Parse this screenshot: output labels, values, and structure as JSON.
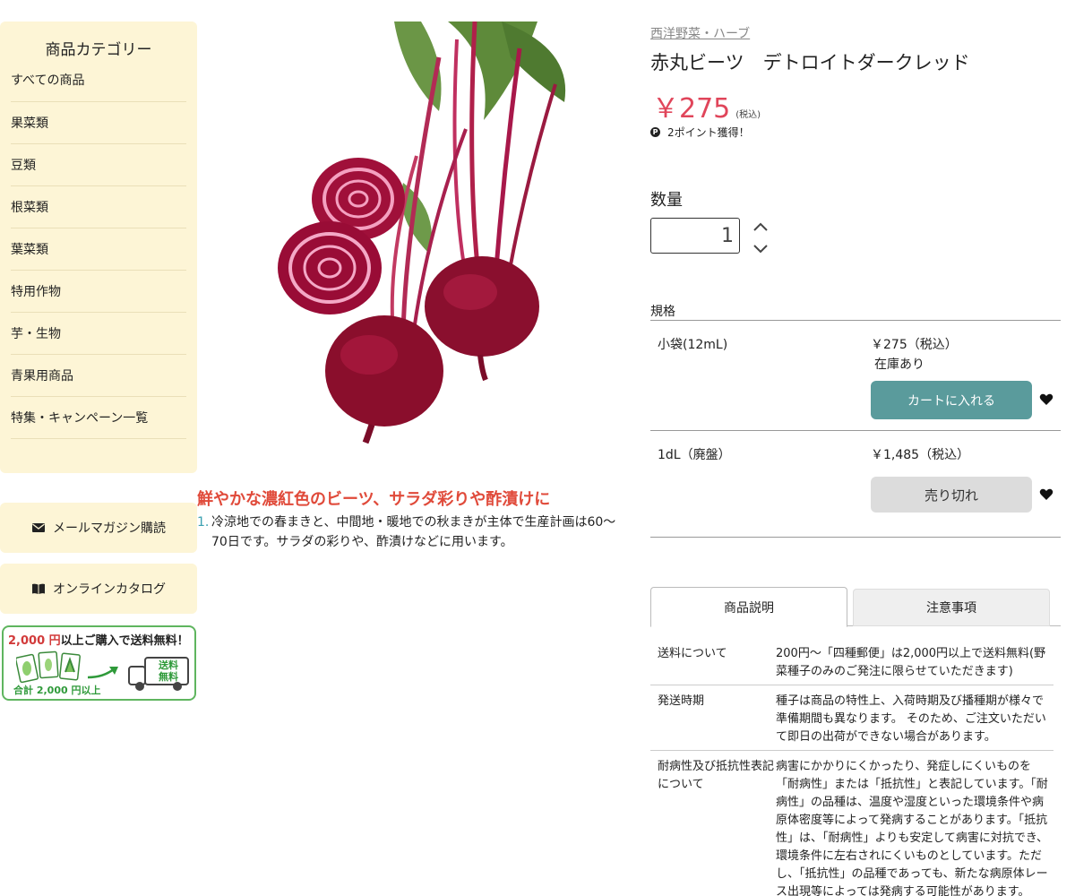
{
  "sidebar": {
    "category_title": "商品カテゴリー",
    "categories": [
      "すべての商品",
      "果菜類",
      "豆類",
      "根菜類",
      "葉菜類",
      "特用作物",
      "芋・生物",
      "青果用商品",
      "特集・キャンペーン一覧"
    ],
    "newsletter_label": "メールマガジン購読",
    "catalog_label": "オンラインカタログ",
    "shipping_banner": {
      "amount": "2,000 円",
      "text": "以上ご購入で送料無料！",
      "sub": "合計 2,000 円以上",
      "truck_text": "送料無料"
    }
  },
  "product": {
    "breadcrumb": "西洋野菜・ハーブ",
    "title": "赤丸ビーツ　デトロイトダークレッド",
    "price": "￥275",
    "tax_note": "(税込)",
    "points": "2ポイント獲得！",
    "catchphrase": "鮮やかな濃紅色のビーツ、サラダ彩りや酢漬けに",
    "description_num": "1.",
    "description": "冷涼地での春まきと、中間地・暖地での秋まきが主体で生産計画は60～70日です。サラダの彩りや、酢漬けなどに用います。"
  },
  "quantity": {
    "label": "数量",
    "value": "1"
  },
  "spec": {
    "label": "規格",
    "rows": [
      {
        "name": "小袋(12mL)",
        "price": "￥275（税込）",
        "stock": "在庫あり",
        "button": "カートに入れる"
      },
      {
        "name": "1dL（廃盤）",
        "price": "￥1,485（税込）",
        "button": "売り切れ"
      }
    ]
  },
  "tabs": [
    "商品説明",
    "注意事項"
  ],
  "info": [
    {
      "key": "送料について",
      "value": "200円～「四種郵便」は2,000円以上で送料無料(野菜種子のみのご発注に限らせていただきます)"
    },
    {
      "key": "発送時期",
      "value": "種子は商品の特性上、入荷時期及び播種期が様々で準備期間も異なります。 そのため、ご注文いただいて即日の出荷ができない場合があります。"
    },
    {
      "key": "耐病性及び抵抗性表記について",
      "value": "病害にかかりにくかったり、発症しにくいものを「耐病性」または「抵抗性」と表記しています。「耐病性」の品種は、温度や湿度といった環境条件や病原体密度等によって発病することがあります。「抵抗性」は、「耐病性」よりも安定して病害に対抗でき、環境条件に左右されにくいものとしています。ただし、「抵抗性」の品種であっても、新たな病原体レース出現等によっては発病する可能性があります。"
    }
  ],
  "colors": {
    "accent_red": "#e0455a",
    "cart_teal": "#5a9b9c",
    "sidebar_bg": "#fdf5d6",
    "catch_red": "#e04a3a"
  }
}
